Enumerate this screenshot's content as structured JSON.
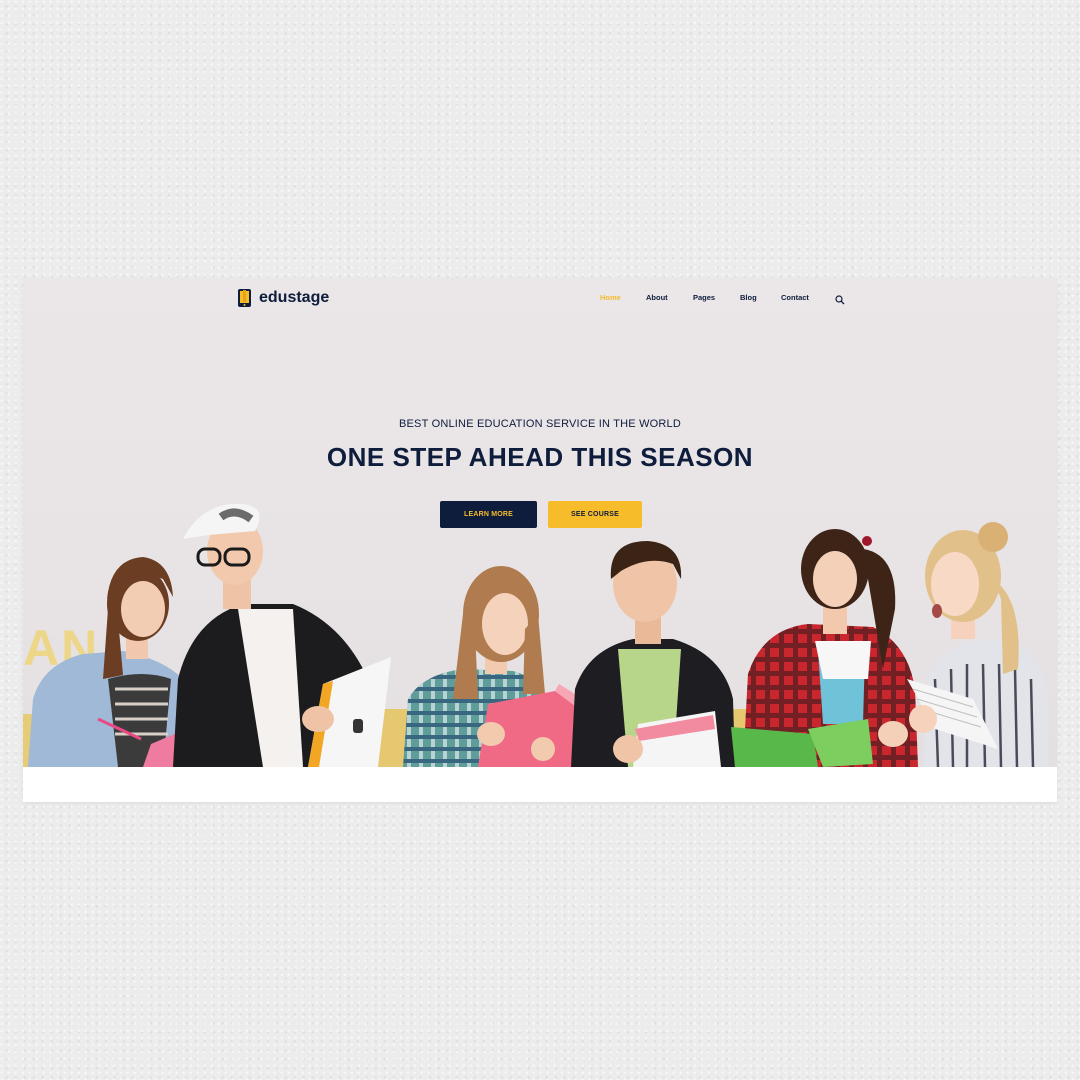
{
  "brand": {
    "name": "edustage",
    "logo_icon": "book-phone-icon"
  },
  "nav": {
    "items": [
      {
        "label": "Home",
        "active": true
      },
      {
        "label": "About",
        "active": false
      },
      {
        "label": "Pages",
        "active": false
      },
      {
        "label": "Blog",
        "active": false
      },
      {
        "label": "Contact",
        "active": false
      }
    ],
    "search_icon": "search-icon"
  },
  "hero": {
    "subtitle": "BEST ONLINE EDUCATION SERVICE IN THE WORLD",
    "title": "ONE STEP AHEAD THIS SEASON",
    "primary_button": "LEARN MORE",
    "secondary_button": "SEE COURSE"
  },
  "colors": {
    "navy": "#0e1d3c",
    "accent": "#f7bc2a",
    "hero_bg": "#ebe6e8",
    "page_bg": "#ececec"
  }
}
